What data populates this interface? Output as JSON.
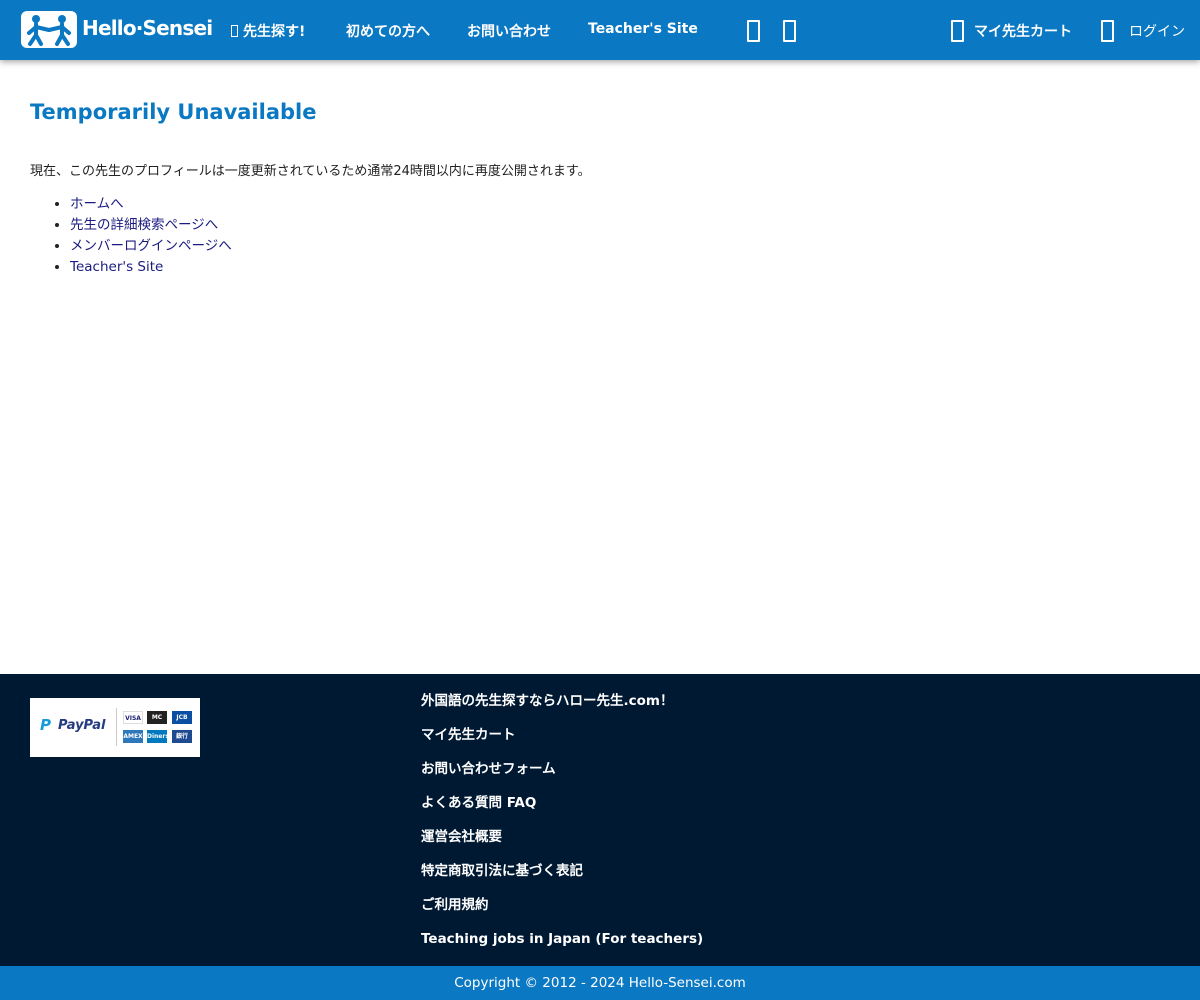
{
  "header": {
    "logo_text": "Hello·Sensei",
    "nav": [
      {
        "label": "先生探す!"
      },
      {
        "label": "初めての方へ"
      },
      {
        "label": "お問い合わせ"
      },
      {
        "label": "Teacher's Site"
      }
    ],
    "cart_label": "マイ先生カート",
    "login_label": "ログイン"
  },
  "main": {
    "title": "Temporarily Unavailable",
    "message": "現在、この先生のプロフィールは一度更新されているため通常24時間以内に再度公開されます。",
    "links": [
      {
        "label": "ホームへ"
      },
      {
        "label": "先生の詳細検索ページへ"
      },
      {
        "label": "メンバーログインページへ"
      },
      {
        "label": "Teacher's Site"
      }
    ]
  },
  "footer": {
    "paypal_label": "PayPal",
    "card_labels": [
      "VISA",
      "MC",
      "JCB",
      "AMEX",
      "Diners",
      "銀行"
    ],
    "links": [
      {
        "label": "外国語の先生探すならハロー先生.com！"
      },
      {
        "label": "マイ先生カート"
      },
      {
        "label": "お問い合わせフォーム"
      },
      {
        "label": "よくある質問 FAQ"
      },
      {
        "label": "運営会社概要"
      },
      {
        "label": "特定商取引法に基づく表記"
      },
      {
        "label": "ご利用規約"
      },
      {
        "label": "Teaching jobs in Japan (For teachers)"
      }
    ],
    "copyright": "Copyright © 2012 - 2024 Hello-Sensei.com"
  },
  "colors": {
    "brand_blue": "#0a78c2",
    "footer_navy": "#001933",
    "link_color": "#1a1a80"
  }
}
